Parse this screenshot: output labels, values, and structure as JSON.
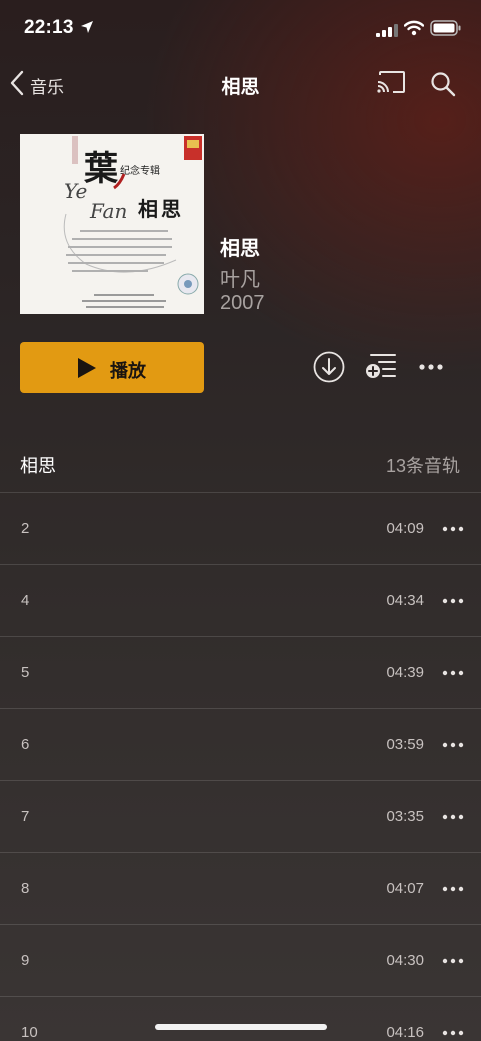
{
  "status_bar": {
    "time": "22:13",
    "icons": [
      "location-arrow-icon",
      "cellular-signal-icon",
      "wifi-icon",
      "battery-icon"
    ]
  },
  "nav": {
    "back_label": "音乐",
    "title": "相思",
    "icons": [
      "chevron-left-icon",
      "cast-icon",
      "search-icon"
    ]
  },
  "album": {
    "title": "相思",
    "artist": "叶凡",
    "year": "2007",
    "art": {
      "big_char": "葉",
      "latin_1": "Ye",
      "latin_2": "Fan",
      "subtitle": "纪念专辑",
      "art_title": "相思"
    }
  },
  "actions": {
    "play_label": "播放",
    "icons": [
      "play-icon",
      "download-icon",
      "add-to-queue-icon",
      "more-icon"
    ]
  },
  "section": {
    "title": "相思",
    "track_count": "13条音轨"
  },
  "tracks": [
    {
      "number": "2",
      "duration": "04:09"
    },
    {
      "number": "4",
      "duration": "04:34"
    },
    {
      "number": "5",
      "duration": "04:39"
    },
    {
      "number": "6",
      "duration": "03:59"
    },
    {
      "number": "7",
      "duration": "03:35"
    },
    {
      "number": "8",
      "duration": "04:07"
    },
    {
      "number": "9",
      "duration": "04:30"
    },
    {
      "number": "10",
      "duration": "04:16"
    }
  ],
  "colors": {
    "accent": "#e29a12",
    "secondary_text": "#a8a2a0"
  }
}
